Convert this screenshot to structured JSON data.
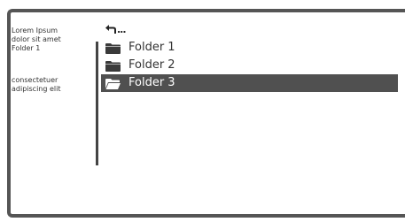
{
  "sidebar": {
    "group1": [
      "Lorem Ipsum",
      "dolor sit amet",
      "Folder 1"
    ],
    "group2": [
      "consectetuer",
      "adipiscing elit"
    ]
  },
  "navigation": {
    "back_icon": "back-arrow-icon",
    "ellipsis": "..."
  },
  "folders": [
    {
      "label": "Folder 1",
      "icon": "folder-icon",
      "selected": false
    },
    {
      "label": "Folder 2",
      "icon": "folder-icon",
      "selected": false
    },
    {
      "label": "Folder 3",
      "icon": "open-folder-icon",
      "selected": true
    }
  ],
  "colors": {
    "selection": "#505050",
    "frame": "#555555"
  }
}
